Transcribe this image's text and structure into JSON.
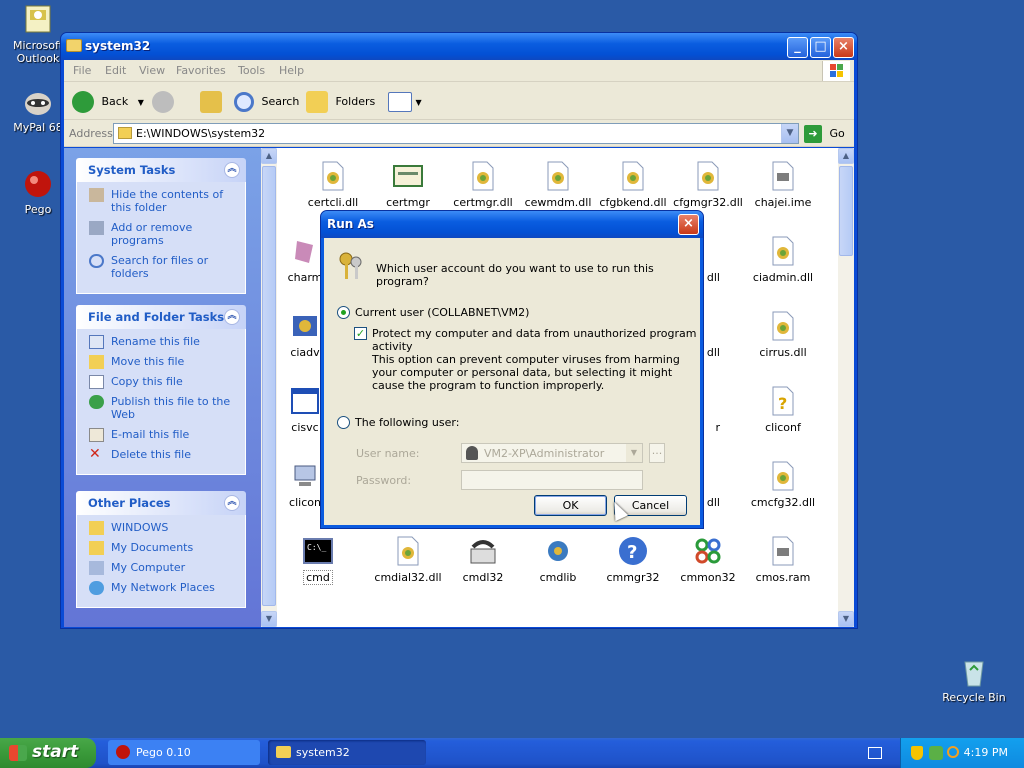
{
  "desktop": {
    "icons": [
      {
        "label": "Microsoft Outlook"
      },
      {
        "label": "MyPal 68"
      },
      {
        "label": "Pego"
      },
      {
        "label": "Recycle Bin"
      }
    ]
  },
  "window": {
    "title": "system32",
    "menu": [
      "File",
      "Edit",
      "View",
      "Favorites",
      "Tools",
      "Help"
    ],
    "toolbar": {
      "back": "Back",
      "search": "Search",
      "folders": "Folders"
    },
    "address": {
      "label": "Address",
      "value": "E:\\WINDOWS\\system32",
      "go": "Go"
    }
  },
  "taskpane": {
    "system_tasks": {
      "title": "System Tasks",
      "items": [
        "Hide the contents of this folder",
        "Add or remove programs",
        "Search for files or folders"
      ]
    },
    "file_tasks": {
      "title": "File and Folder Tasks",
      "items": [
        "Rename this file",
        "Move this file",
        "Copy this file",
        "Publish this file to the Web",
        "E-mail this file",
        "Delete this file"
      ]
    },
    "other_places": {
      "title": "Other Places",
      "items": [
        "WINDOWS",
        "My Documents",
        "My Computer",
        "My Network Places"
      ]
    }
  },
  "files": [
    {
      "name": "certcli.dll"
    },
    {
      "name": "certmgr"
    },
    {
      "name": "certmgr.dll"
    },
    {
      "name": "cewmdm.dll"
    },
    {
      "name": "cfgbkend.dll"
    },
    {
      "name": "cfgmgr32.dll"
    },
    {
      "name": "chajei.ime"
    },
    {
      "name": "charm"
    },
    {
      "name": "dll"
    },
    {
      "name": "ciadmin.dll"
    },
    {
      "name": "ciadv"
    },
    {
      "name": "dll"
    },
    {
      "name": "cirrus.dll"
    },
    {
      "name": "cisvc"
    },
    {
      "name": "r"
    },
    {
      "name": "cliconf"
    },
    {
      "name": "clicon"
    },
    {
      "name": "dll"
    },
    {
      "name": "cmcfg32.dll"
    },
    {
      "name": "cmd"
    },
    {
      "name": "cmdial32.dll"
    },
    {
      "name": "cmdl32"
    },
    {
      "name": "cmdlib"
    },
    {
      "name": "cmmgr32"
    },
    {
      "name": "cmmon32"
    },
    {
      "name": "cmos.ram"
    }
  ],
  "dialog": {
    "title": "Run As",
    "question": "Which user account do you want to use to run this program?",
    "current_user": "Current user (COLLABNET\\VM2)",
    "protect": "Protect my computer and data from unauthorized program activity",
    "protect_note": "This option can prevent computer viruses from harming your computer or personal data, but selecting it might cause the program to function improperly.",
    "following_user": "The following user:",
    "username_label": "User name:",
    "username_value": "VM2-XP\\Administrator",
    "password_label": "Password:",
    "browse": "...",
    "ok": "OK",
    "cancel": "Cancel"
  },
  "taskbar": {
    "start": "start",
    "items": [
      "Pego 0.10",
      "system32"
    ],
    "clock": "4:19 PM"
  },
  "colors": {
    "accent": "#0a5de0",
    "taskbar": "#245edb",
    "link": "#215dc6"
  }
}
